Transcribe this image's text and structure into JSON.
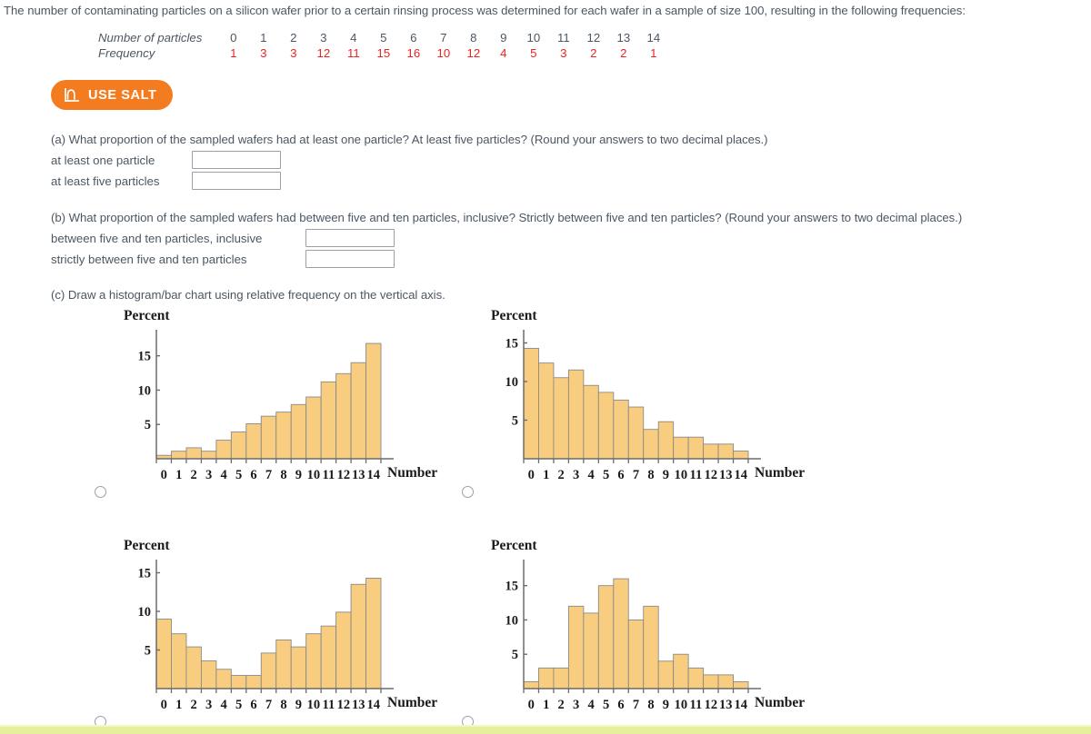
{
  "intro": {
    "text": "The number of contaminating particles on a silicon wafer prior to a certain rinsing process was determined for each wafer in a sample of size 100, resulting in the following frequencies:"
  },
  "table": {
    "row_labels": [
      "Number of particles",
      "Frequency"
    ],
    "particles": [
      "0",
      "1",
      "2",
      "3",
      "4",
      "5",
      "6",
      "7",
      "8",
      "9",
      "10",
      "11",
      "12",
      "13",
      "14"
    ],
    "frequencies": [
      "1",
      "3",
      "3",
      "12",
      "11",
      "15",
      "16",
      "10",
      "12",
      "4",
      "5",
      "3",
      "2",
      "2",
      "1"
    ]
  },
  "salt": {
    "label": "USE SALT",
    "icon": "distribution-curve-icon",
    "color": "#f47c20"
  },
  "questions": {
    "a": {
      "prompt": "(a) What proportion of the sampled wafers had at least one particle? At least five particles? (Round your answers to two decimal places.)",
      "rows": [
        {
          "label": "at least one particle",
          "value": "",
          "placeholder": ""
        },
        {
          "label": "at least five particles",
          "value": "",
          "placeholder": ""
        }
      ]
    },
    "b": {
      "prompt": "(b) What proportion of the sampled wafers had between five and ten particles, inclusive? Strictly between five and ten particles? (Round your answers to two decimal places.)",
      "rows": [
        {
          "label": "between five and ten particles, inclusive",
          "value": "",
          "placeholder": ""
        },
        {
          "label": "strictly between five and ten particles",
          "value": "",
          "placeholder": ""
        }
      ]
    },
    "c": {
      "prompt": "(c) Draw a histogram/bar chart using relative frequency on the vertical axis."
    }
  },
  "chart_data": [
    {
      "id": "option-a",
      "type": "bar",
      "title": "",
      "xlabel": "Number",
      "ylabel": "Percent",
      "categories": [
        "0",
        "1",
        "2",
        "3",
        "4",
        "5",
        "6",
        "7",
        "8",
        "9",
        "10",
        "11",
        "12",
        "13",
        "14"
      ],
      "values": [
        0.5,
        1.1,
        1.6,
        1.1,
        2.7,
        3.9,
        5.1,
        6.2,
        6.8,
        7.9,
        9.0,
        11.2,
        12.4,
        14.0,
        16.8
      ],
      "yticks": [
        5,
        10,
        15
      ],
      "ylim": [
        0,
        18
      ],
      "grid": false,
      "selected": false
    },
    {
      "id": "option-b",
      "type": "bar",
      "title": "",
      "xlabel": "Number",
      "ylabel": "Percent",
      "categories": [
        "0",
        "1",
        "2",
        "3",
        "4",
        "5",
        "6",
        "7",
        "8",
        "9",
        "10",
        "11",
        "12",
        "13",
        "14"
      ],
      "values": [
        14.3,
        12.4,
        10.5,
        11.5,
        9.5,
        8.6,
        7.6,
        6.7,
        3.8,
        4.8,
        2.8,
        2.8,
        1.9,
        1.9,
        1.0
      ],
      "yticks": [
        5,
        10,
        15
      ],
      "ylim": [
        0,
        16
      ],
      "grid": false,
      "selected": false
    },
    {
      "id": "option-c",
      "type": "bar",
      "title": "",
      "xlabel": "Number",
      "ylabel": "Percent",
      "categories": [
        "0",
        "1",
        "2",
        "3",
        "4",
        "5",
        "6",
        "7",
        "8",
        "9",
        "10",
        "11",
        "12",
        "13",
        "14"
      ],
      "values": [
        9.0,
        7.1,
        5.4,
        3.6,
        2.5,
        1.7,
        1.7,
        4.6,
        6.3,
        5.4,
        7.1,
        8.1,
        9.9,
        13.5,
        14.3
      ],
      "yticks": [
        5,
        10,
        15
      ],
      "ylim": [
        0,
        16
      ],
      "grid": false,
      "selected": false
    },
    {
      "id": "option-d",
      "type": "bar",
      "title": "",
      "xlabel": "Number",
      "ylabel": "Percent",
      "categories": [
        "0",
        "1",
        "2",
        "3",
        "4",
        "5",
        "6",
        "7",
        "8",
        "9",
        "10",
        "11",
        "12",
        "13",
        "14"
      ],
      "values": [
        1,
        3,
        3,
        12,
        11,
        15,
        16,
        10,
        12,
        4,
        5,
        3,
        2,
        2,
        1
      ],
      "yticks": [
        5,
        10,
        15
      ],
      "ylim": [
        0,
        18
      ],
      "grid": false,
      "selected": false
    }
  ],
  "style": {
    "bar_fill": "#f9cd80",
    "bar_stroke": "#8a8a8a",
    "axis_color": "#6b6b6b",
    "frequency_text_color": "#ee2222",
    "body_text_color": "#4c5763",
    "footer_band_color": "#e6ef9a"
  }
}
